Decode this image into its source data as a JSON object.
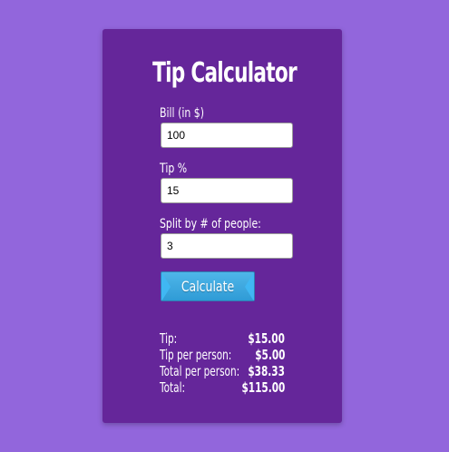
{
  "title": "Tip Calculator",
  "fields": {
    "bill": {
      "label": "Bill (in $)",
      "value": "100"
    },
    "tip": {
      "label": "Tip %",
      "value": "15"
    },
    "split": {
      "label": "Split by # of people:",
      "value": "3"
    }
  },
  "button": {
    "label": "Calculate"
  },
  "results": {
    "tip": {
      "label": "Tip:",
      "value": "$15.00"
    },
    "tip_per_person": {
      "label": "Tip per person:",
      "value": "$5.00"
    },
    "total_per_person": {
      "label": "Total per person:",
      "value": "$38.33"
    },
    "total": {
      "label": "Total:",
      "value": "$115.00"
    }
  },
  "colors": {
    "page_background": "#9266dc",
    "card_background": "#65269a",
    "button": "#3aa6dd"
  }
}
